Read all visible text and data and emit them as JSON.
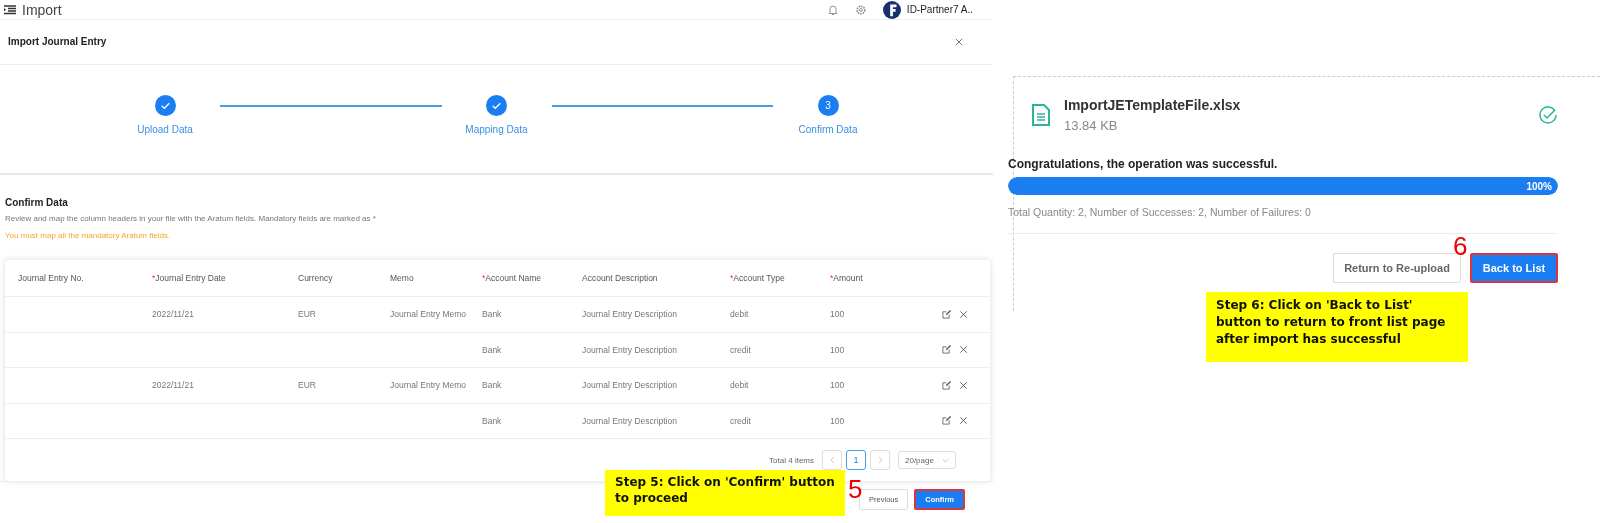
{
  "app_bar": {
    "title": "Import",
    "user": "ID-Partner7 A.."
  },
  "dialog": {
    "title": "Import Journal Entry"
  },
  "steps": [
    {
      "label": "Upload Data",
      "completed": true
    },
    {
      "label": "Mapping Data",
      "completed": true
    },
    {
      "label": "Confirm Data",
      "completed": false,
      "number": "3"
    }
  ],
  "section": {
    "title": "Confirm Data",
    "description": "Review and map the column headers in your file with the Aratum fields. Mandatory fields are marked as *",
    "warning": "You must map all the mandatory Aratum fields."
  },
  "table": {
    "columns": [
      {
        "label": "Journal Entry No."
      },
      {
        "label": "Journal Entry Date",
        "required_mark": "*"
      },
      {
        "label": "Currency"
      },
      {
        "label": "Memo"
      },
      {
        "label": "Account Name",
        "required_mark": "*"
      },
      {
        "label": "Account Description"
      },
      {
        "label": "Account Type",
        "required_mark": "*"
      },
      {
        "label": "Amount",
        "required_mark": "*"
      }
    ],
    "rows": [
      [
        null,
        "2022/11/21",
        "EUR",
        "Journal Entry Memo",
        "Bank",
        "Journal Entry Description",
        "debit",
        "100"
      ],
      [
        null,
        null,
        null,
        null,
        "Bank",
        "Journal Entry Description",
        "credit",
        "100"
      ],
      [
        null,
        "2022/11/21",
        "EUR",
        "Journal Entry Memo",
        "Bank",
        "Journal Entry Description",
        "debit",
        "100"
      ],
      [
        null,
        null,
        null,
        null,
        "Bank",
        "Journal Entry Description",
        "credit",
        "100"
      ]
    ]
  },
  "pagination": {
    "total": "Total 4 items",
    "pages": [
      {
        "label": "1",
        "selected": true
      }
    ],
    "page_size": "20/page"
  },
  "footer_buttons": [
    {
      "label": "Previous",
      "kind": "default"
    },
    {
      "label": "Confirm",
      "kind": "primary"
    }
  ],
  "result": {
    "file_name": "ImportJETemplateFile.xlsx",
    "file_size": "13.84 KB",
    "message": "Congratulations, the operation was successful.",
    "level": 1,
    "percent": "100%",
    "summary": "Total Quantity: 2, Number of Successes: 2, Number of Failures: 0",
    "buttons": [
      {
        "label": "Return to Re-upload",
        "kind": "default"
      },
      {
        "label": "Back to List",
        "kind": "primary"
      }
    ]
  },
  "callouts": [
    {
      "number": "5",
      "text": "Step 5: Click on 'Confirm' button to proceed"
    },
    {
      "number": "6",
      "text": "Step 6: Click on 'Back to List' button to return to front list page after import has successful"
    }
  ]
}
